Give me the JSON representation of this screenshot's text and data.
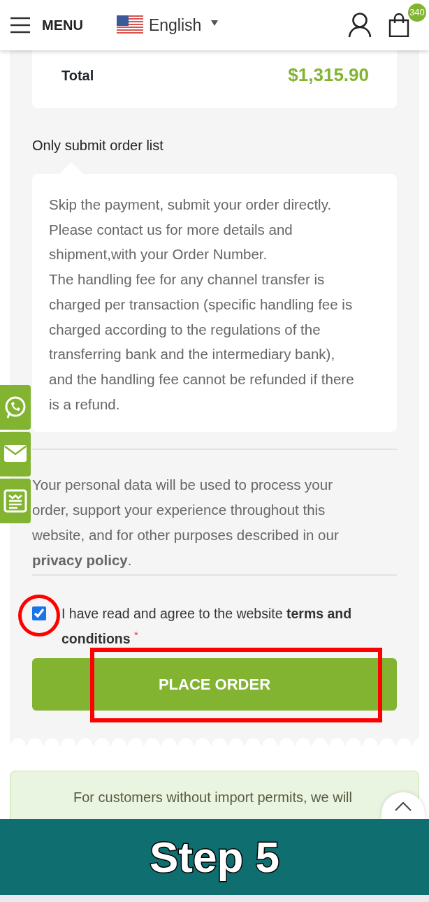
{
  "header": {
    "menu_label": "MENU",
    "language": "English",
    "cart_count": "340"
  },
  "total": {
    "label": "Total",
    "value": "$1,315.90"
  },
  "payment_option": {
    "title": "Only submit order list",
    "paragraphs": [
      "Skip the payment, submit your order directly. Please contact us for more details and shipment,with your Order Number.",
      "The handling fee for any channel transfer is charged per transaction (specific handling fee is charged according to the regulations of the transferring bank and the intermediary bank), and the handling fee cannot be refunded if there is a refund."
    ]
  },
  "privacy_text": "Your personal data will be used to process your order, support your experience throughout this website, and for other purposes described in our **privacy policy**.",
  "terms": {
    "checked": true,
    "text": "I have read and agree to the website **terms and conditions**",
    "required_mark": "*"
  },
  "place_order_button": "PLACE ORDER",
  "notice": "For customers without import permits, we will",
  "side_buttons": [
    {
      "kind": "whatsapp"
    },
    {
      "kind": "mail"
    },
    {
      "kind": "form"
    }
  ],
  "banner": "Step 5"
}
